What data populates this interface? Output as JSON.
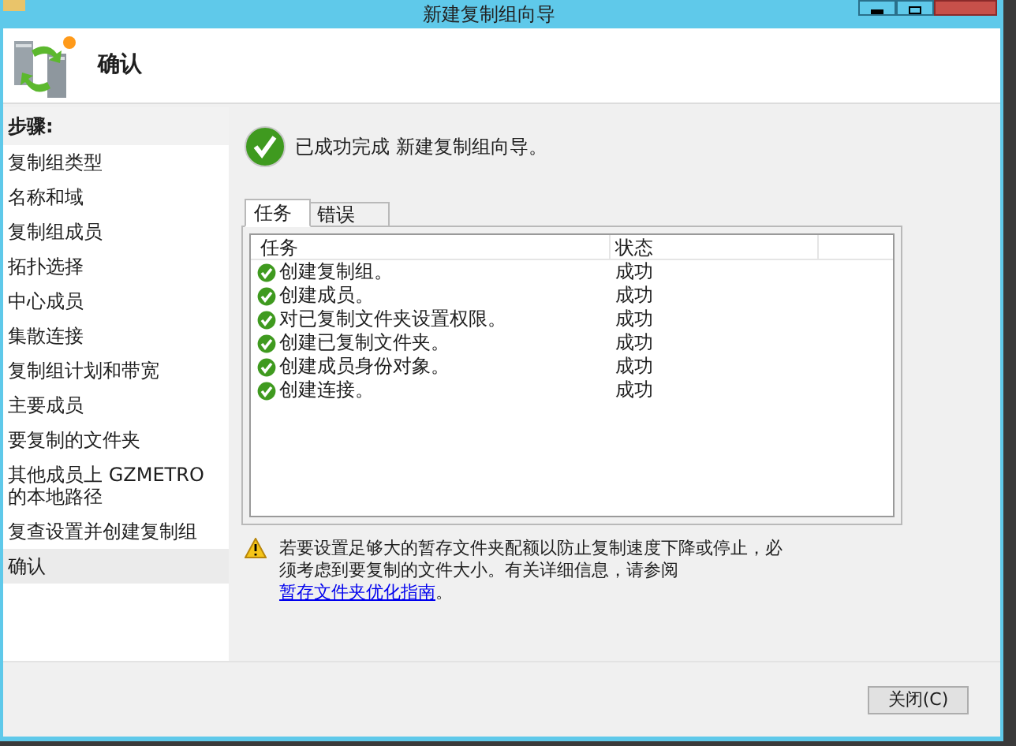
{
  "window": {
    "title": "新建复制组向导"
  },
  "header": {
    "title": "确认"
  },
  "steps": {
    "heading": "步骤:",
    "items": [
      {
        "label": "复制组类型",
        "selected": false
      },
      {
        "label": "名称和域",
        "selected": false
      },
      {
        "label": "复制组成员",
        "selected": false
      },
      {
        "label": "拓扑选择",
        "selected": false
      },
      {
        "label": "中心成员",
        "selected": false
      },
      {
        "label": "集散连接",
        "selected": false
      },
      {
        "label": "复制组计划和带宽",
        "selected": false
      },
      {
        "label": "主要成员",
        "selected": false
      },
      {
        "label": "要复制的文件夹",
        "selected": false
      },
      {
        "label": "其他成员上 GZMETRO 的本地路径",
        "selected": false
      },
      {
        "label": "复查设置并创建复制组",
        "selected": false
      },
      {
        "label": "确认",
        "selected": true
      }
    ]
  },
  "result": {
    "message": "已成功完成 新建复制组向导。"
  },
  "tabs": [
    {
      "label": "任务",
      "selected": true
    },
    {
      "label": "错误",
      "selected": false
    }
  ],
  "table": {
    "columns": [
      "任务",
      "状态"
    ],
    "rows": [
      {
        "task": "创建复制组。",
        "status": "成功"
      },
      {
        "task": "创建成员。",
        "status": "成功"
      },
      {
        "task": "对已复制文件夹设置权限。",
        "status": "成功"
      },
      {
        "task": "创建已复制文件夹。",
        "status": "成功"
      },
      {
        "task": "创建成员身份对象。",
        "status": "成功"
      },
      {
        "task": "创建连接。",
        "status": "成功"
      }
    ]
  },
  "warning": {
    "text": "若要设置足够大的暂存文件夹配额以防止复制速度下降或停止，必须考虑到要复制的文件大小。有关详细信息，请参阅",
    "link": "暂存文件夹优化指南",
    "text_after": "。"
  },
  "buttons": [
    {
      "label": "关闭(C)"
    }
  ]
}
